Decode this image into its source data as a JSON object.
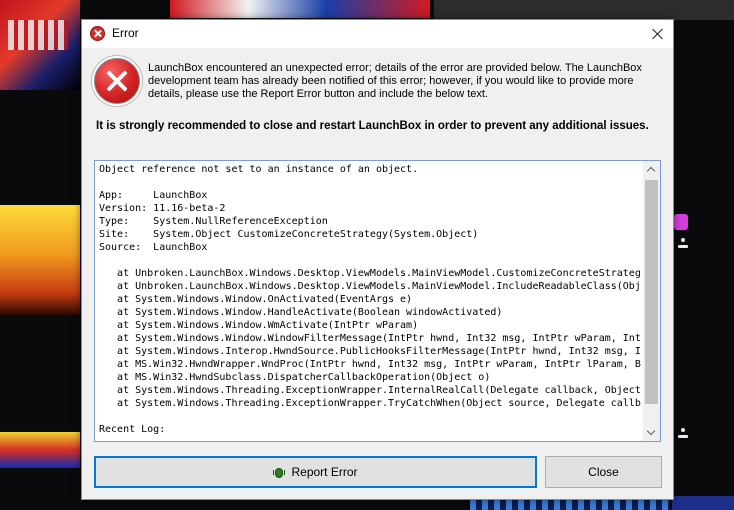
{
  "dialog": {
    "title": "Error",
    "close_glyph": "×",
    "message": "LaunchBox encountered an unexpected error; details of the error are provided below. The LaunchBox development team has already been notified of this error; however, if you would like to provide more details, please use the Report Error button and include the below text.",
    "warning": "It is strongly recommended to close and restart LaunchBox in order to prevent any additional issues.",
    "details_lines": [
      "Object reference not set to an instance of an object.",
      "",
      "App:     LaunchBox",
      "Version: 11.16-beta-2",
      "Type:    System.NullReferenceException",
      "Site:    System.Object CustomizeConcreteStrategy(System.Object)",
      "Source:  LaunchBox",
      "",
      "   at Unbroken.LaunchBox.Windows.Desktop.ViewModels.MainViewModel.CustomizeConcreteStrateg",
      "   at Unbroken.LaunchBox.Windows.Desktop.ViewModels.MainViewModel.IncludeReadableClass(Obj",
      "   at System.Windows.Window.OnActivated(EventArgs e)",
      "   at System.Windows.Window.HandleActivate(Boolean windowActivated)",
      "   at System.Windows.Window.WmActivate(IntPtr wParam)",
      "   at System.Windows.Window.WindowFilterMessage(IntPtr hwnd, Int32 msg, IntPtr wParam, Int",
      "   at System.Windows.Interop.HwndSource.PublicHooksFilterMessage(IntPtr hwnd, Int32 msg, I",
      "   at MS.Win32.HwndWrapper.WndProc(IntPtr hwnd, Int32 msg, IntPtr wParam, IntPtr lParam, B",
      "   at MS.Win32.HwndSubclass.DispatcherCallbackOperation(Object o)",
      "   at System.Windows.Threading.ExceptionWrapper.InternalRealCall(Delegate callback, Object",
      "   at System.Windows.Threading.ExceptionWrapper.TryCatchWhen(Object source, Delegate callb",
      "",
      "Recent Log:"
    ],
    "buttons": {
      "report": "Report Error",
      "close": "Close"
    }
  },
  "icons": {
    "title": "error-icon",
    "message": "error-large-icon",
    "report": "bug-icon"
  },
  "colors": {
    "accent": "#0078d7",
    "error": "#d22222",
    "dialog_bg": "#f0f0f0"
  }
}
